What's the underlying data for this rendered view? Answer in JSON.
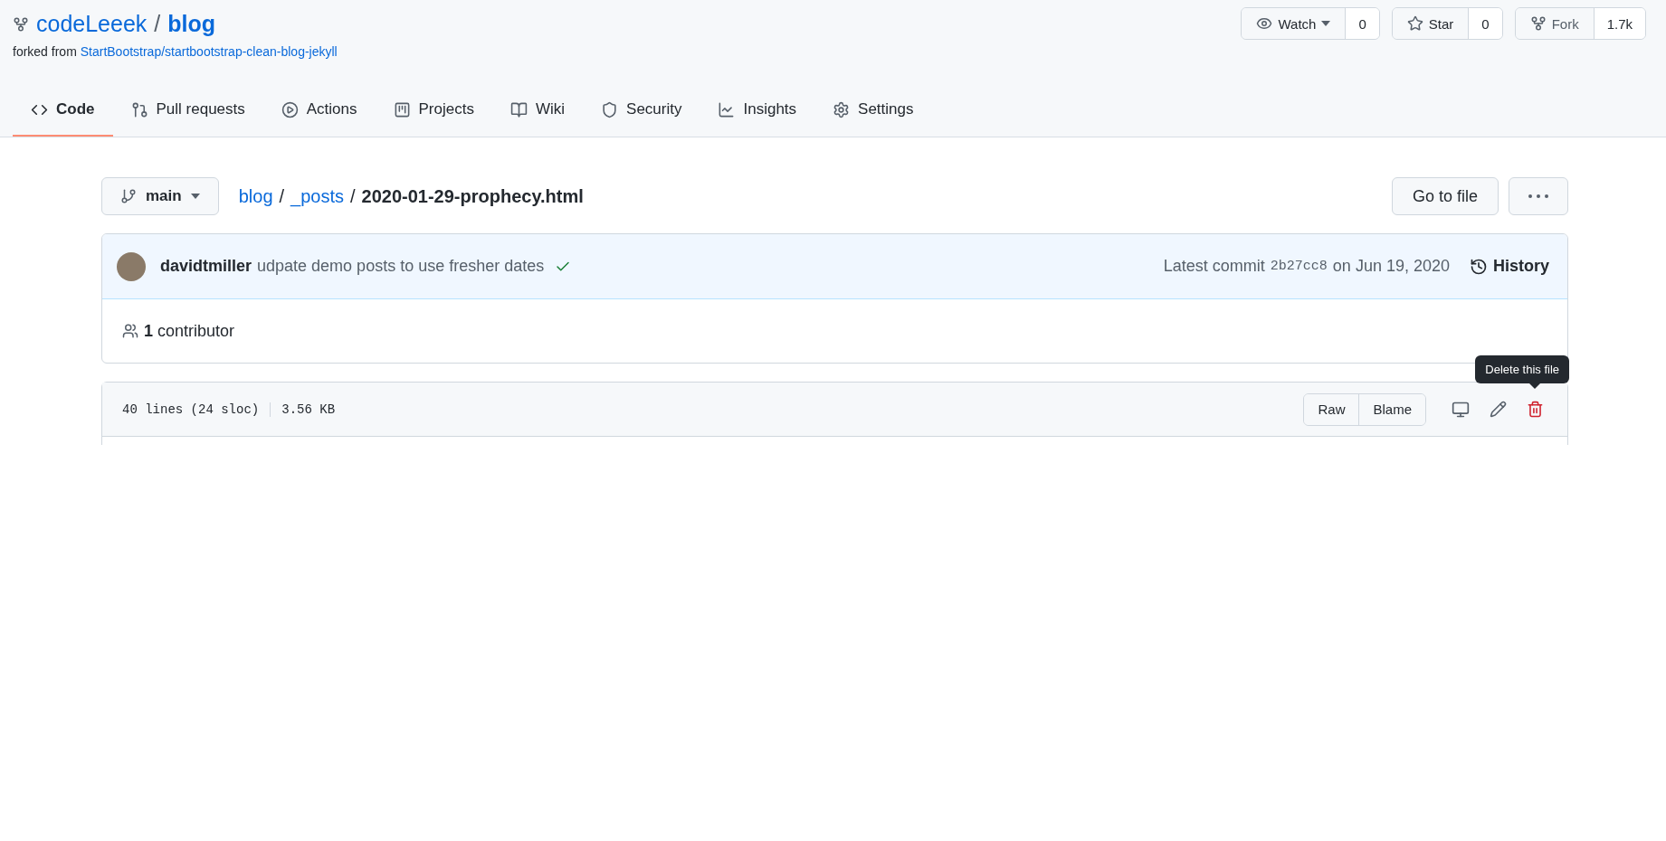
{
  "repo": {
    "owner": "codeLeeek",
    "separator": "/",
    "name": "blog",
    "forked_prefix": "forked from",
    "forked_link": "StartBootstrap/startbootstrap-clean-blog-jekyll"
  },
  "actions": [
    {
      "kind": "watch",
      "label": "Watch",
      "count": "0"
    },
    {
      "kind": "star",
      "label": "Star",
      "count": "0"
    },
    {
      "kind": "fork",
      "label": "Fork",
      "count": "1.7k"
    }
  ],
  "tabs": [
    {
      "kind": "code",
      "label": "Code",
      "selected": true
    },
    {
      "kind": "pulls",
      "label": "Pull requests",
      "selected": false
    },
    {
      "kind": "actions",
      "label": "Actions",
      "selected": false
    },
    {
      "kind": "projects",
      "label": "Projects",
      "selected": false
    },
    {
      "kind": "wiki",
      "label": "Wiki",
      "selected": false
    },
    {
      "kind": "security",
      "label": "Security",
      "selected": false
    },
    {
      "kind": "insights",
      "label": "Insights",
      "selected": false
    },
    {
      "kind": "settings",
      "label": "Settings",
      "selected": false
    }
  ],
  "branch": "main",
  "breadcrumb": [
    {
      "label": "blog",
      "link": true
    },
    {
      "label": "/",
      "link": false
    },
    {
      "label": "_posts",
      "link": true
    },
    {
      "label": "/",
      "link": false
    },
    {
      "label": "2020-01-29-prophecy.html",
      "link": false
    }
  ],
  "go_to_file": "Go to file",
  "commit": {
    "author": "davidtmiller",
    "message": "udpate demo posts to use fresher dates",
    "latest_label": "Latest commit",
    "sha": "2b27cc8",
    "date": "on Jun 19, 2020",
    "history": "History"
  },
  "contributors": "**1** contributor",
  "file": {
    "lines": "40 lines (24 sloc)",
    "size": "3.56 KB",
    "buttons": [
      "Raw",
      "Blame"
    ],
    "tooltip": "Delete this file"
  }
}
